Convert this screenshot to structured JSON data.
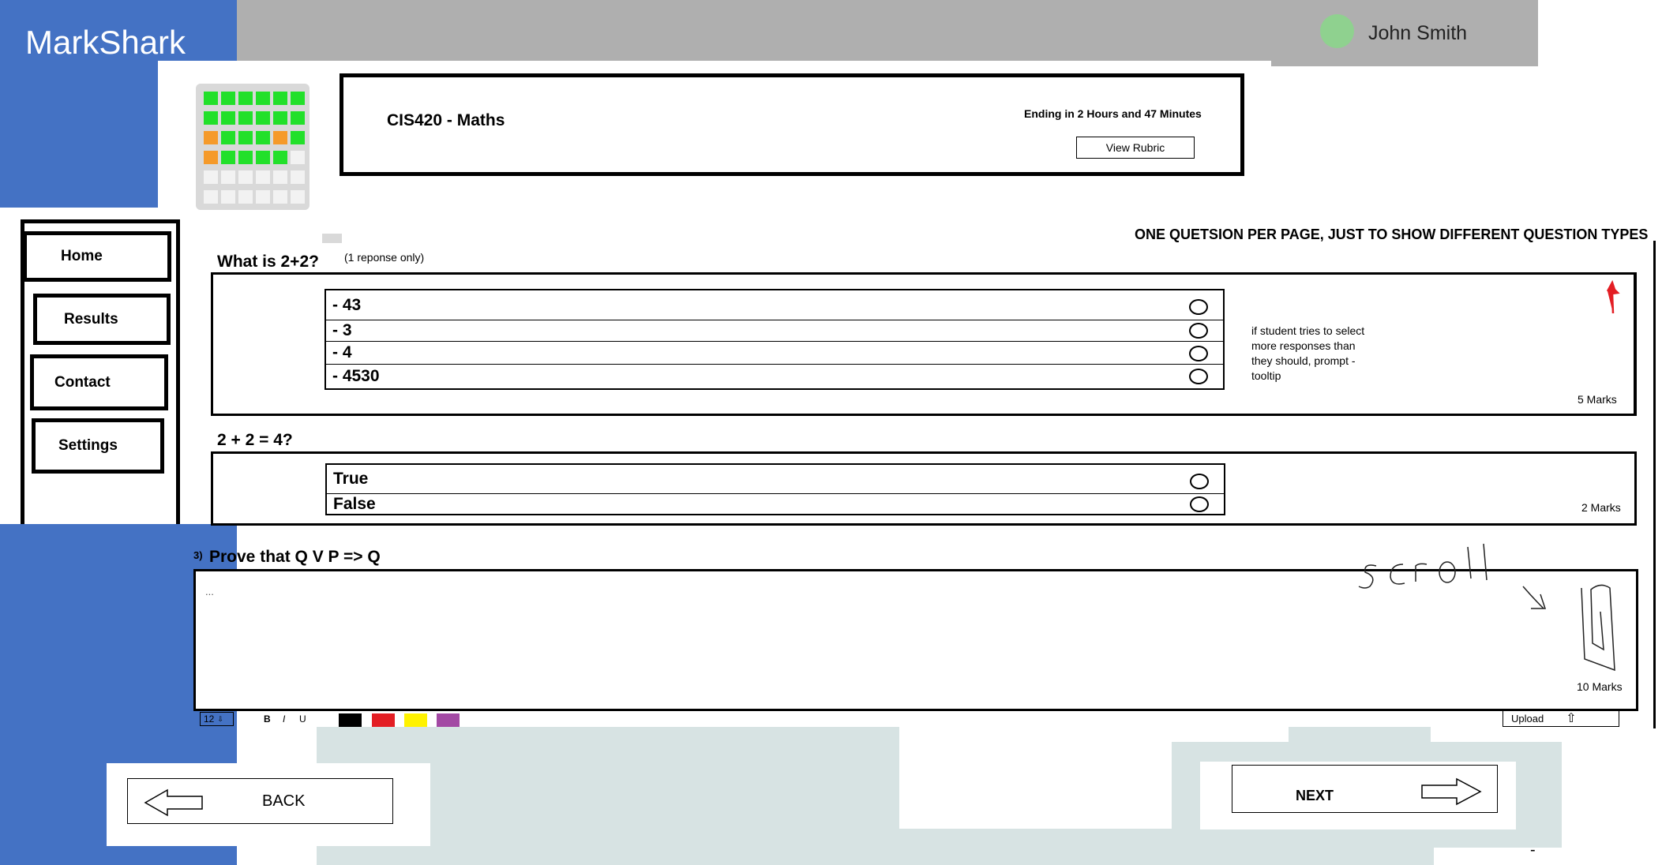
{
  "app": {
    "name": "MarkShark"
  },
  "user": {
    "name": "John Smith",
    "avatar_color": "#8fd18f"
  },
  "exam": {
    "title": "CIS420 - Maths",
    "timer": "Ending in 2 Hours and 47 Minutes",
    "rubric_button": "View Rubric",
    "progress_grid": [
      [
        "green",
        "green",
        "green",
        "green",
        "green",
        "green"
      ],
      [
        "green",
        "green",
        "green",
        "green",
        "green",
        "green"
      ],
      [
        "orange",
        "green",
        "green",
        "green",
        "orange",
        "green"
      ],
      [
        "orange",
        "green",
        "green",
        "green",
        "green",
        "white"
      ],
      [
        "white",
        "white",
        "white",
        "white",
        "white",
        "white"
      ],
      [
        "white",
        "white",
        "white",
        "white",
        "white",
        "white"
      ]
    ]
  },
  "sidebar": {
    "items": [
      {
        "label": "Home"
      },
      {
        "label": "Results"
      },
      {
        "label": "Contact"
      },
      {
        "label": "Settings"
      }
    ]
  },
  "notice": "ONE QUETSION PER PAGE, JUST TO SHOW DIFFERENT QUESTION TYPES",
  "questions": [
    {
      "prompt": "What is 2+2?",
      "hint": "(1 reponse only)",
      "options": [
        "- 43",
        "- 3",
        "- 4",
        "- 4530"
      ],
      "note": [
        "if student tries to select",
        "more responses than",
        "they should, prompt -",
        "tooltip"
      ],
      "marks": "5 Marks"
    },
    {
      "prompt": "2 + 2 = 4?",
      "options": [
        "True",
        "False"
      ],
      "marks": "2 Marks"
    },
    {
      "number": "3)",
      "prompt": "Prove that Q V P => Q",
      "answer_placeholder": "...",
      "marks": "10 Marks",
      "scroll_annotation": "scroll",
      "toolbar": {
        "font_size": "12",
        "bold": "B",
        "italic": "I",
        "underline": "U",
        "colors": [
          "#000000",
          "#e31e24",
          "#fff200",
          "#a349a4"
        ],
        "upload": "Upload"
      }
    }
  ],
  "footer": {
    "back": "BACK",
    "next": "NEXT",
    "dash": "-"
  }
}
